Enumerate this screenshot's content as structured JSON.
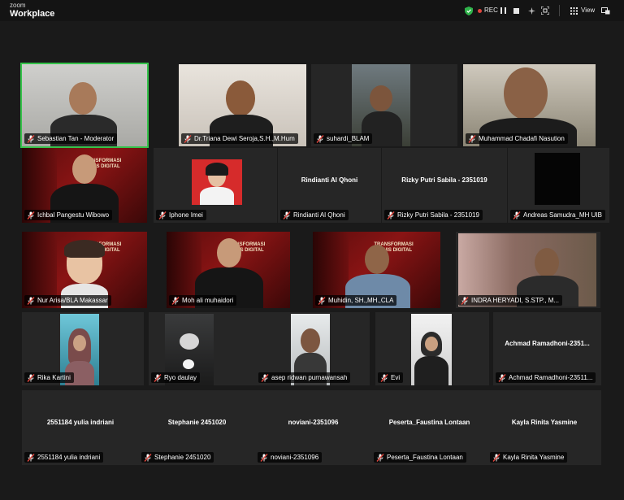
{
  "app": {
    "brand_top": "zoom",
    "brand_bottom": "Workplace"
  },
  "toolbar": {
    "rec": "REC",
    "view": "View"
  },
  "colors": {
    "active_speaker": "#35c24a",
    "mic_muted": "#e0463d",
    "tile_bg": "#262626"
  },
  "participants": [
    {
      "label": "Sebastian Tan - Moderator",
      "muted": true,
      "active": true
    },
    {
      "label": "Dr.Triana Dewi Seroja,S.H.,M.Hum",
      "muted": true
    },
    {
      "label": "suhardi_BLAM",
      "muted": true
    },
    {
      "label": "Muhammad Chadafi Nasution",
      "muted": true
    },
    {
      "label": "Ichbal Pangestu Wibowo",
      "muted": true
    },
    {
      "label": "Iphone Imei",
      "muted": true
    },
    {
      "label": "Rindianti Al Qhoni",
      "center": "Rindianti Al Qhoni",
      "muted": true
    },
    {
      "label": "Rizky Putri Sabila - 2351019",
      "center": "Rizky Putri Sabila - 2351019",
      "muted": true
    },
    {
      "label": "Andreas Samudra_MH UIB",
      "muted": true
    },
    {
      "label": "Nur Arisa/BLA Makassar",
      "muted": true
    },
    {
      "label": "Moh ali muhaidori",
      "muted": true
    },
    {
      "label": "Muhidin, SH.,MH.,CLA",
      "muted": true
    },
    {
      "label": "INDRA HERYADI, S.STP., M...",
      "muted": true
    },
    {
      "label": "Rika Kartini",
      "muted": true
    },
    {
      "label": "Ryo daulay",
      "muted": true
    },
    {
      "label": "asep ridwan purnawansah",
      "muted": true
    },
    {
      "label": "Evi",
      "muted": true
    },
    {
      "label": "Achmad Ramadhoni-23511...",
      "center": "Achmad Ramadhoni-2351...",
      "muted": true
    },
    {
      "label": "2551184 yulia indriani",
      "center": "2551184 yulia indriani",
      "muted": true
    },
    {
      "label": "Stephanie 2451020",
      "center": "Stephanie 2451020",
      "muted": true
    },
    {
      "label": "noviani-2351096",
      "center": "noviani-2351096",
      "muted": true
    },
    {
      "label": "Peserta_Faustina Lontaan",
      "center": "Peserta_Faustina Lontaan",
      "muted": true
    },
    {
      "label": "Kayla Rinita Yasmine",
      "center": "Kayla Rinita Yasmine",
      "muted": true
    }
  ],
  "banner": {
    "title_1": "TRANSFORMASI",
    "title_2": "BISNIS DIGITAL"
  }
}
